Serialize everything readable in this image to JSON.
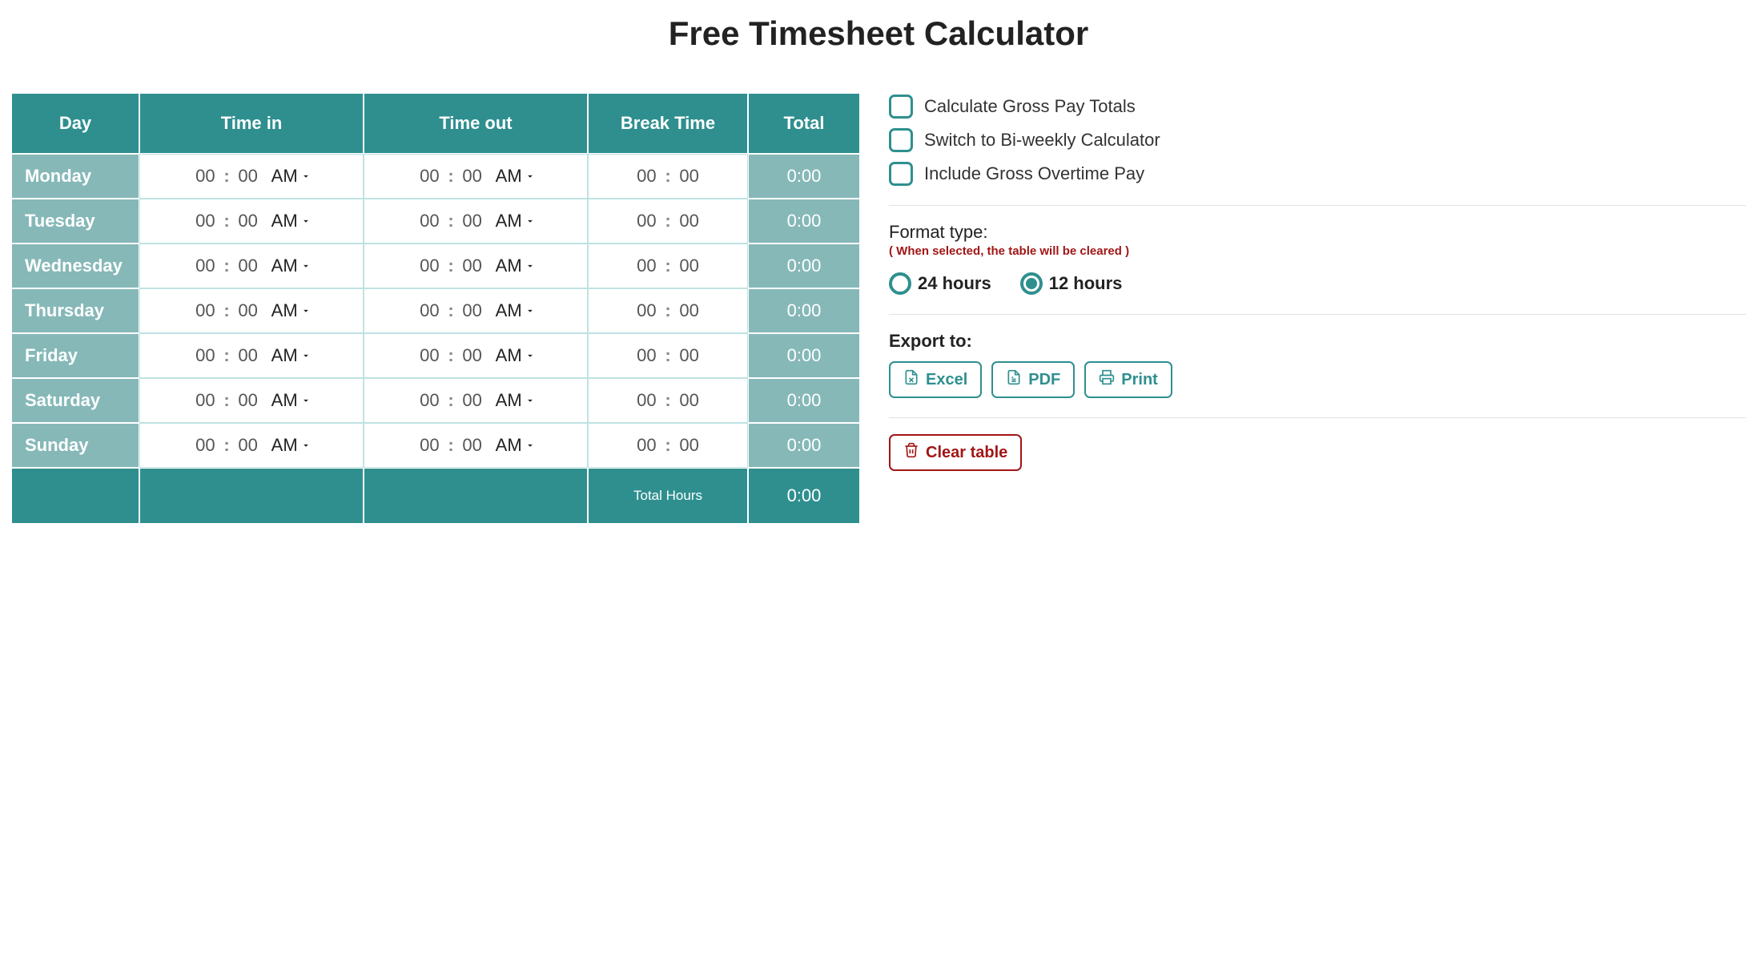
{
  "title": "Free Timesheet Calculator",
  "columns": {
    "day": "Day",
    "time_in": "Time in",
    "time_out": "Time out",
    "break": "Break Time",
    "total": "Total"
  },
  "rows": [
    {
      "day": "Monday",
      "in_hh": "00",
      "in_mm": "00",
      "in_ampm": "AM",
      "out_hh": "00",
      "out_mm": "00",
      "out_ampm": "AM",
      "br_hh": "00",
      "br_mm": "00",
      "total": "0:00"
    },
    {
      "day": "Tuesday",
      "in_hh": "00",
      "in_mm": "00",
      "in_ampm": "AM",
      "out_hh": "00",
      "out_mm": "00",
      "out_ampm": "AM",
      "br_hh": "00",
      "br_mm": "00",
      "total": "0:00"
    },
    {
      "day": "Wednesday",
      "in_hh": "00",
      "in_mm": "00",
      "in_ampm": "AM",
      "out_hh": "00",
      "out_mm": "00",
      "out_ampm": "AM",
      "br_hh": "00",
      "br_mm": "00",
      "total": "0:00"
    },
    {
      "day": "Thursday",
      "in_hh": "00",
      "in_mm": "00",
      "in_ampm": "AM",
      "out_hh": "00",
      "out_mm": "00",
      "out_ampm": "AM",
      "br_hh": "00",
      "br_mm": "00",
      "total": "0:00"
    },
    {
      "day": "Friday",
      "in_hh": "00",
      "in_mm": "00",
      "in_ampm": "AM",
      "out_hh": "00",
      "out_mm": "00",
      "out_ampm": "AM",
      "br_hh": "00",
      "br_mm": "00",
      "total": "0:00"
    },
    {
      "day": "Saturday",
      "in_hh": "00",
      "in_mm": "00",
      "in_ampm": "AM",
      "out_hh": "00",
      "out_mm": "00",
      "out_ampm": "AM",
      "br_hh": "00",
      "br_mm": "00",
      "total": "0:00"
    },
    {
      "day": "Sunday",
      "in_hh": "00",
      "in_mm": "00",
      "in_ampm": "AM",
      "out_hh": "00",
      "out_mm": "00",
      "out_ampm": "AM",
      "br_hh": "00",
      "br_mm": "00",
      "total": "0:00"
    }
  ],
  "footer": {
    "label": "Total Hours",
    "total": "0:00"
  },
  "sidebar": {
    "options": [
      "Calculate Gross Pay Totals",
      "Switch to Bi-weekly Calculator",
      "Include Gross Overtime Pay"
    ],
    "format": {
      "label": "Format type:",
      "warning": "( When selected, the table will be cleared )",
      "opt24": "24 hours",
      "opt12": "12 hours",
      "selected": "12"
    },
    "export": {
      "label": "Export to:",
      "excel": "Excel",
      "pdf": "PDF",
      "print": "Print"
    },
    "clear": "Clear table"
  }
}
